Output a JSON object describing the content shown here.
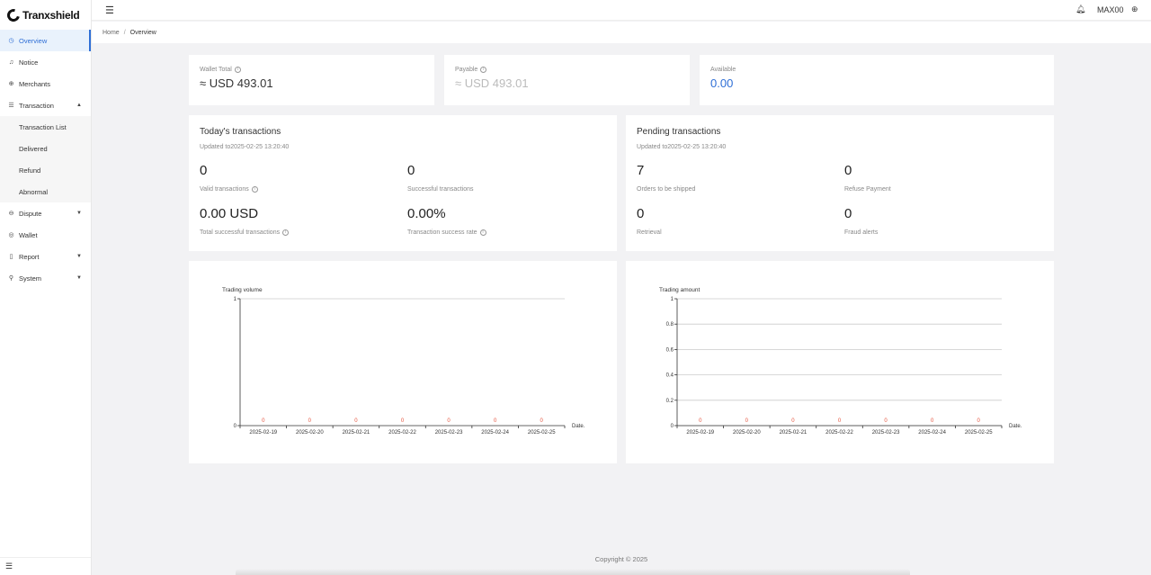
{
  "app": {
    "name": "Tranxshield"
  },
  "sidebar": {
    "items": [
      {
        "label": "Overview",
        "icon": "dashboard-icon"
      },
      {
        "label": "Notice",
        "icon": "bell-icon"
      },
      {
        "label": "Merchants",
        "icon": "globe-icon"
      },
      {
        "label": "Transaction",
        "icon": "list-icon"
      },
      {
        "label": "Dispute",
        "icon": "dispute-icon"
      },
      {
        "label": "Wallet",
        "icon": "wallet-icon"
      },
      {
        "label": "Report",
        "icon": "report-icon"
      },
      {
        "label": "System",
        "icon": "system-icon"
      }
    ],
    "transaction_sub": [
      "Transaction List",
      "Delivered",
      "Refund",
      "Abnormal"
    ]
  },
  "header": {
    "user": "MAX00"
  },
  "breadcrumb": {
    "home": "Home",
    "sep": "/",
    "current": "Overview"
  },
  "balances": {
    "wallet_total": {
      "label": "Wallet Total",
      "value": "≈ USD 493.01"
    },
    "payable": {
      "label": "Payable",
      "value": "≈ USD 493.01"
    },
    "available": {
      "label": "Available",
      "value": "0.00"
    }
  },
  "today": {
    "title": "Today's transactions",
    "updated": "Updated to2025-02-25 13:20:40",
    "valid_value": "0",
    "valid_label": "Valid transactions",
    "success_value": "0",
    "success_label": "Successful transactions",
    "total_value": "0.00 USD",
    "total_label": "Total successful transactions",
    "rate_value": "0.00%",
    "rate_label": "Transaction success rate"
  },
  "pending": {
    "title": "Pending transactions",
    "updated": "Updated to2025-02-25 13:20:40",
    "ship_value": "7",
    "ship_label": "Orders to be shipped",
    "refuse_value": "0",
    "refuse_label": "Refuse Payment",
    "retrieval_value": "0",
    "retrieval_label": "Retrieval",
    "fraud_value": "0",
    "fraud_label": "Fraud alerts"
  },
  "chart_data": [
    {
      "type": "bar",
      "title": "Trading volume",
      "xlabel": "Date.",
      "ylabel": "",
      "categories": [
        "2025-02-19",
        "2025-02-20",
        "2025-02-21",
        "2025-02-22",
        "2025-02-23",
        "2025-02-24",
        "2025-02-25"
      ],
      "values": [
        0,
        0,
        0,
        0,
        0,
        0,
        0
      ],
      "yticks": [
        "0",
        "1"
      ],
      "ylim": [
        0,
        1
      ],
      "label_color": "#e5533d",
      "grid": false
    },
    {
      "type": "bar",
      "title": "Trading amount",
      "xlabel": "Date.",
      "ylabel": "",
      "categories": [
        "2025-02-19",
        "2025-02-20",
        "2025-02-21",
        "2025-02-22",
        "2025-02-23",
        "2025-02-24",
        "2025-02-25"
      ],
      "values": [
        0,
        0,
        0,
        0,
        0,
        0,
        0
      ],
      "yticks": [
        "0",
        "0.2",
        "0.4",
        "0.6",
        "0.8",
        "1"
      ],
      "ylim": [
        0,
        1
      ],
      "label_color": "#e5533d",
      "grid": true
    }
  ],
  "footer": {
    "text": "Copyright © 2025"
  }
}
